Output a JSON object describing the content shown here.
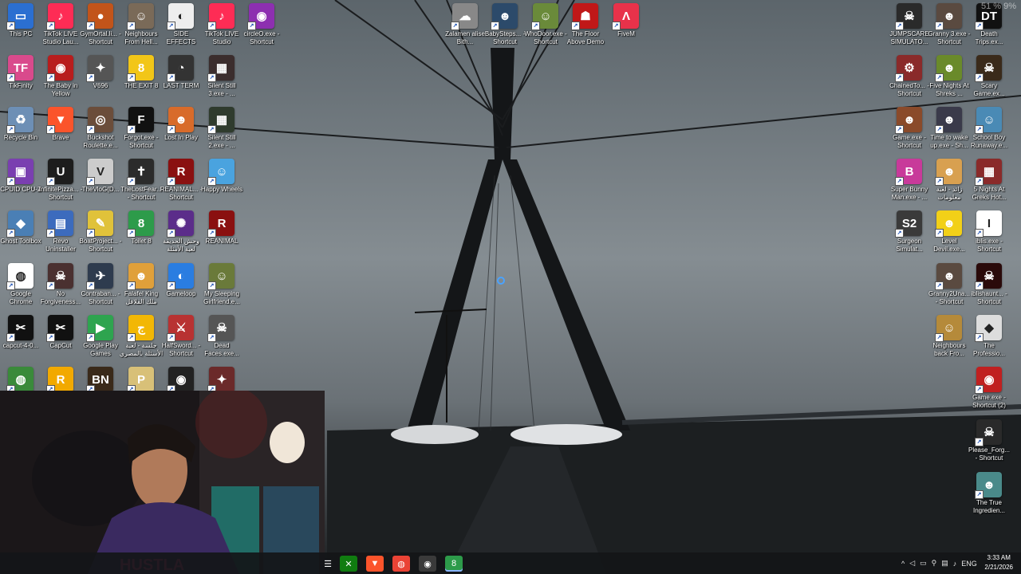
{
  "desktop": {
    "icons_left": [
      {
        "label": "This PC",
        "bg": "#2b6fd1",
        "glyph": "▭"
      },
      {
        "label": "TikTok LIVE Studio Lau...",
        "bg": "#fe2c55",
        "glyph": "♪"
      },
      {
        "label": "GymOrtal.li... - Shortcut",
        "bg": "#c2541a",
        "glyph": "●"
      },
      {
        "label": "Neighbours From Hell...",
        "bg": "#7a6a58",
        "glyph": "☺"
      },
      {
        "label": "SIDE EFFECTS",
        "bg": "#eeeeee",
        "glyph": "◐"
      },
      {
        "label": "TikTok LIVE Studio",
        "bg": "#fe2c55",
        "glyph": "♪"
      },
      {
        "label": "circleO.exe - Shortcut",
        "bg": "#8d2fb0",
        "glyph": "◉"
      },
      {
        "label": "TikFinity",
        "bg": "#d94a8c",
        "glyph": "TF"
      },
      {
        "label": "The Baby in Yellow",
        "bg": "#b81d1d",
        "glyph": "◉"
      },
      {
        "label": "V696",
        "bg": "#555555",
        "glyph": "✦"
      },
      {
        "label": "THE EXIT 8",
        "bg": "#f2c618",
        "glyph": "8"
      },
      {
        "label": "LAST TERM",
        "bg": "#333333",
        "glyph": "◔"
      },
      {
        "label": "Silent Still 3.exe - ...",
        "bg": "#3b2d2d",
        "glyph": "▦"
      },
      {
        "label": "Recycle Bin",
        "bg": "#6d8fb5",
        "glyph": "♻"
      },
      {
        "label": "Brave",
        "bg": "#fb542b",
        "glyph": "▼"
      },
      {
        "label": "Buckshot Roulette.e...",
        "bg": "#6b4d3a",
        "glyph": "◎"
      },
      {
        "label": "Forgot.exe - Shortcut",
        "bg": "#111111",
        "glyph": "F"
      },
      {
        "label": "Lost In Play",
        "bg": "#d86b2a",
        "glyph": "☻"
      },
      {
        "label": "Silent Still 2.exe - ...",
        "bg": "#2f3b2d",
        "glyph": "▦"
      },
      {
        "label": "CPUID CPU-Z",
        "bg": "#7a3fb0",
        "glyph": "▣"
      },
      {
        "label": "InfinitePizza... - Shortcut",
        "bg": "#1d1d1d",
        "glyph": "U"
      },
      {
        "label": "TheVloG(D...",
        "bg": "#cccccc",
        "glyph": "V"
      },
      {
        "label": "TheLostFear... - Shortcut",
        "bg": "#2b2b2b",
        "glyph": "✝"
      },
      {
        "label": "REANIMAL... - Shortcut",
        "bg": "#8a1010",
        "glyph": "R"
      },
      {
        "label": "Happy Wheels",
        "bg": "#4aa3df",
        "glyph": "☺"
      },
      {
        "label": "Ghost Toolbox",
        "bg": "#4a7fb5",
        "glyph": "◆"
      },
      {
        "label": "Revo Uninstaller",
        "bg": "#3c6bbd",
        "glyph": "▤"
      },
      {
        "label": "BoatProject... - Shortcut",
        "bg": "#e0c23a",
        "glyph": "✎"
      },
      {
        "label": "Toilet 8",
        "bg": "#2d9b4a",
        "glyph": "8"
      },
      {
        "label": "وحش الحديقة لعبة الأمثلة",
        "bg": "#5b2d8a",
        "glyph": "✺"
      },
      {
        "label": "REANIMAL",
        "bg": "#8a1010",
        "glyph": "R"
      },
      {
        "label": "Google Chrome",
        "bg": "#ffffff",
        "glyph": "◍"
      },
      {
        "label": "No Forgiveness...",
        "bg": "#4a3030",
        "glyph": "☠"
      },
      {
        "label": "Contraban... - Shortcut",
        "bg": "#2e3b4e",
        "glyph": "✈"
      },
      {
        "label": "Falafel King ملك الفلافل",
        "bg": "#e0a03a",
        "glyph": "☻"
      },
      {
        "label": "Gameloop",
        "bg": "#2a7de1",
        "glyph": "◐"
      },
      {
        "label": "My Sleeping Girlfriend.e...",
        "bg": "#6a7a3a",
        "glyph": "☺"
      },
      {
        "label": "capcut-4-0...",
        "bg": "#111111",
        "glyph": "✂"
      },
      {
        "label": "CapCut",
        "bg": "#111111",
        "glyph": "✂"
      },
      {
        "label": "Google Play Games",
        "bg": "#2ea44f",
        "glyph": "▶"
      },
      {
        "label": "جلسة - لعبة الأسئلة بالمصري",
        "bg": "#f2b705",
        "glyph": "ج"
      },
      {
        "label": "HalfSword... - Shortcut",
        "bg": "#b83232",
        "glyph": "⚔"
      },
      {
        "label": "Dead Faces.exe...",
        "bg": "#555555",
        "glyph": "☠"
      },
      {
        "label": "",
        "bg": "#3a8a3a",
        "glyph": "◍"
      },
      {
        "label": "",
        "bg": "#f2a900",
        "glyph": "R"
      },
      {
        "label": "",
        "bg": "#3a2a1a",
        "glyph": "BN"
      },
      {
        "label": "",
        "bg": "#d8c078",
        "glyph": "P"
      },
      {
        "label": "",
        "bg": "#222222",
        "glyph": "◉"
      },
      {
        "label": "",
        "bg": "#6b2a2a",
        "glyph": "✦"
      }
    ],
    "icons_top": [
      {
        "label": "Zalamen alise Bith...",
        "bg": "#888888",
        "glyph": "☁"
      },
      {
        "label": "BabySteps... - Shortcut",
        "bg": "#2c4a6a",
        "glyph": "☻"
      },
      {
        "label": "WhoDoor.exe - Shortcut",
        "bg": "#6a8a3a",
        "glyph": "☺"
      },
      {
        "label": "The Floor Above Demo",
        "bg": "#c01818",
        "glyph": "☗"
      },
      {
        "label": "FiveM",
        "bg": "#e8324a",
        "glyph": "Λ"
      }
    ],
    "icons_right": [
      {
        "label": "JUMPSCARE SIMULATO...",
        "bg": "#2a2a2a",
        "glyph": "☠"
      },
      {
        "label": "Granny 3.exe - Shortcut",
        "bg": "#5a4a40",
        "glyph": "☻"
      },
      {
        "label": "Death Trips.ex...",
        "bg": "#111111",
        "glyph": "DT"
      },
      {
        "label": "ChainedTo... - Shortcut",
        "bg": "#8a2a2a",
        "glyph": "⚙"
      },
      {
        "label": "Five Nights At Shreks ...",
        "bg": "#6a8a2a",
        "glyph": "☻"
      },
      {
        "label": "Scary Game.ex...",
        "bg": "#3a2a1a",
        "glyph": "☠"
      },
      {
        "label": "Game.exe - Shortcut",
        "bg": "#8a4a2a",
        "glyph": "☻"
      },
      {
        "label": "Time to wake up.exe - Sh...",
        "bg": "#3a3a4a",
        "glyph": "☻"
      },
      {
        "label": "School Boy Runaway.e...",
        "bg": "#4a8ab5",
        "glyph": "☺"
      },
      {
        "label": "Super Bunny Man.exe - ...",
        "bg": "#c83a9a",
        "glyph": "B"
      },
      {
        "label": "زائد - لعبة معلومات",
        "bg": "#d8a050",
        "glyph": "☻"
      },
      {
        "label": "5 Nights At Greks Hot...",
        "bg": "#8a2a2a",
        "glyph": "▦"
      },
      {
        "label": "Surgeon Simulat...",
        "bg": "#3a3a3a",
        "glyph": "S2"
      },
      {
        "label": "Level Devil.exe...",
        "bg": "#f2d018",
        "glyph": "☻"
      },
      {
        "label": "iblis.exe - Shortcut",
        "bg": "#ffffff",
        "glyph": "I"
      },
      {
        "label": "Granny2Una... - Shortcut",
        "bg": "#5a4a40",
        "glyph": "☻"
      },
      {
        "label": "iblishaunt... - Shortcut",
        "bg": "#2a0a0a",
        "glyph": "☠"
      },
      {
        "label": "Neighbours back Fro...",
        "bg": "#b58a3a",
        "glyph": "☺"
      },
      {
        "label": "The Professio...",
        "bg": "#dddddd",
        "glyph": "◆"
      },
      {
        "label": "Game.exe - Shortcut (2)",
        "bg": "#c02020",
        "glyph": "◉"
      },
      {
        "label": "Please_Forg... - Shortcut",
        "bg": "#2a2a2a",
        "glyph": "☠"
      },
      {
        "label": "The True Ingredien...",
        "bg": "#4a8a8a",
        "glyph": "☻"
      }
    ]
  },
  "corner_text": "51 % 9%",
  "taskbar": {
    "apps": [
      {
        "name": "xbox",
        "glyph": "✕",
        "bg": "#107c10"
      },
      {
        "name": "brave",
        "glyph": "▼",
        "bg": "#fb542b"
      },
      {
        "name": "chrome",
        "glyph": "◍",
        "bg": "#ea4335"
      },
      {
        "name": "obs",
        "glyph": "◉",
        "bg": "#3a3a3a"
      },
      {
        "name": "toilet8",
        "glyph": "8",
        "bg": "#2d9b4a"
      }
    ],
    "tray_lang": "ENG",
    "time": "3:33 AM",
    "date": "2/21/2026"
  }
}
